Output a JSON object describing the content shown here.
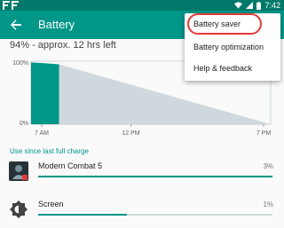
{
  "status_bar": {
    "time": "7:42",
    "icons": [
      "notification-f-icon",
      "notification-f-icon",
      "wifi-icon",
      "signal-icon",
      "battery-icon"
    ]
  },
  "app_bar": {
    "title": "Battery",
    "back_icon": "arrow-back-icon"
  },
  "summary": "94% - approx. 12 hrs left",
  "overflow_menu": {
    "items": [
      {
        "label": "Battery saver",
        "highlighted": true
      },
      {
        "label": "Battery optimization"
      },
      {
        "label": "Help & feedback"
      }
    ],
    "highlight_color": "#e53935"
  },
  "chart_data": {
    "type": "area",
    "title": "",
    "xlabel": "",
    "ylabel": "",
    "y_tick_labels": [
      "100%",
      "0%"
    ],
    "x_tick_labels": [
      "7 AM",
      "12 PM",
      "7 PM"
    ],
    "ylim": [
      0,
      100
    ],
    "series": [
      {
        "values": [
          [
            0,
            98
          ],
          [
            0.6,
            97
          ],
          [
            1.4,
            95
          ]
        ],
        "color": "#009688"
      },
      {
        "values": [
          [
            1.4,
            95
          ],
          [
            12,
            0
          ]
        ],
        "color": "#cfd8dc"
      }
    ]
  },
  "usage": {
    "header": "Use since last full charge",
    "items": [
      {
        "name": "Modern Combat 5",
        "percent_label": "3%",
        "fraction": 1.0,
        "icon": "modern-combat-icon"
      },
      {
        "name": "Screen",
        "percent_label": "1%",
        "fraction": 0.38,
        "icon": "screen-brightness-icon"
      }
    ]
  },
  "colors": {
    "status_bar": "#00796b",
    "app_bar": "#009688",
    "accent": "#009688"
  }
}
